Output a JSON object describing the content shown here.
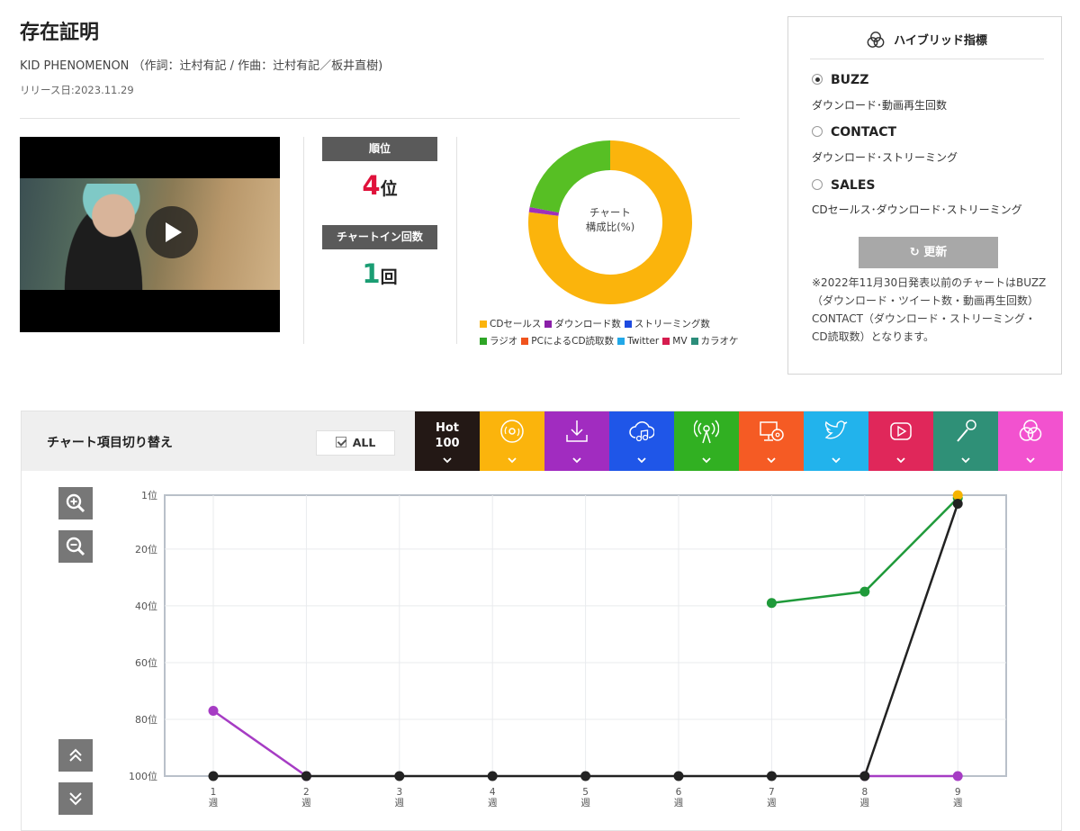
{
  "song": {
    "title": "存在証明",
    "artist_line": "KID PHENOMENON （作詞：辻村有記 / 作曲：辻村有記／板井直樹)",
    "release": "リリース日:2023.11.29"
  },
  "stats": {
    "rank_label": "順位",
    "rank_value": "4",
    "rank_unit": "位",
    "chartin_label": "チャートイン回数",
    "chartin_value": "1",
    "chartin_unit": "回"
  },
  "composition": {
    "center_line1": "チャート",
    "center_line2": "構成比(%)",
    "slices": [
      {
        "name": "CDセールス",
        "value": 77,
        "color": "#fbb40c"
      },
      {
        "name": "ダウンロード数",
        "value": 1,
        "color": "#a030b8"
      },
      {
        "name": "ラジオ",
        "value": 22,
        "color": "#57bf24"
      }
    ],
    "legend": [
      {
        "name": "CDセールス",
        "color": "#fbb40c"
      },
      {
        "name": "ダウンロード数",
        "color": "#8a1fa8"
      },
      {
        "name": "ストリーミング数",
        "color": "#1e4be0"
      },
      {
        "name": "ラジオ",
        "color": "#2ea526"
      },
      {
        "name": "PCによるCD読取数",
        "color": "#f0531d"
      },
      {
        "name": "Twitter",
        "color": "#22a8e8"
      },
      {
        "name": "MV",
        "color": "#d61c4e"
      },
      {
        "name": "カラオケ",
        "color": "#2b8d7a"
      }
    ]
  },
  "hybrid": {
    "heading": "ハイブリッド指標",
    "options": [
      {
        "label": "BUZZ",
        "desc": "ダウンロード･動画再生回数",
        "selected": true
      },
      {
        "label": "CONTACT",
        "desc": "ダウンロード･ストリーミング",
        "selected": false
      },
      {
        "label": "SALES",
        "desc": "CDセールス･ダウンロード･ストリーミング",
        "selected": false
      }
    ],
    "refresh_label": "更新",
    "note": "※2022年11月30日発表以前のチャートはBUZZ（ダウンロード・ツイート数・動画再生回数）CONTACT（ダウンロード・ストリーミング・CD読取数）となります。"
  },
  "switcher": {
    "label": "チャート項目切り替え",
    "all_label": "ALL",
    "hot_line1": "Hot",
    "hot_line2": "100",
    "tabs": [
      {
        "icon": "hot100-icon",
        "color": "#231815"
      },
      {
        "icon": "cd-icon",
        "color": "#fbb40c"
      },
      {
        "icon": "download-icon",
        "color": "#a12cc0"
      },
      {
        "icon": "streaming-cloud-icon",
        "color": "#1f56e8"
      },
      {
        "icon": "radio-icon",
        "color": "#31b022"
      },
      {
        "icon": "pc-cd-icon",
        "color": "#f55b24"
      },
      {
        "icon": "twitter-icon",
        "color": "#22b3ec"
      },
      {
        "icon": "youtube-icon",
        "color": "#e0275a"
      },
      {
        "icon": "karaoke-mic-icon",
        "color": "#2f9077"
      },
      {
        "icon": "hybrid-icon",
        "color": "#f252cf"
      }
    ]
  },
  "chart_data": {
    "type": "line",
    "x": [
      "1\n週",
      "2\n週",
      "3\n週",
      "4\n週",
      "5\n週",
      "6\n週",
      "7\n週",
      "8\n週",
      "9\n週"
    ],
    "y_ticks": [
      "1位",
      "20位",
      "40位",
      "60位",
      "80位",
      "100位"
    ],
    "ylim": [
      1,
      100
    ],
    "y_inverted": true,
    "grid": true,
    "series": [
      {
        "color": "#a63cc4",
        "values": [
          77,
          100,
          null,
          null,
          null,
          null,
          null,
          null,
          null
        ]
      },
      {
        "color": "#a63cc4",
        "values": [
          null,
          null,
          null,
          null,
          null,
          null,
          null,
          100,
          100
        ]
      },
      {
        "color": "#1f9a3a",
        "values": [
          null,
          null,
          null,
          null,
          null,
          null,
          39,
          35,
          2
        ]
      },
      {
        "color": "#f5b400",
        "values": [
          null,
          null,
          null,
          null,
          null,
          null,
          null,
          null,
          1
        ]
      },
      {
        "color": "#222222",
        "values": [
          100,
          100,
          100,
          100,
          100,
          100,
          100,
          100,
          4
        ]
      }
    ]
  }
}
